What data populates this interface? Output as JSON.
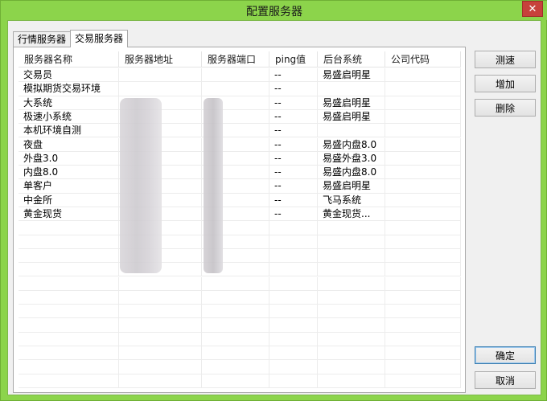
{
  "window": {
    "title": "配置服务器",
    "close_label": "✕"
  },
  "tabs": [
    {
      "label": "行情服务器",
      "active": false
    },
    {
      "label": "交易服务器",
      "active": true
    }
  ],
  "table": {
    "columns": [
      "服务器名称",
      "服务器地址",
      "服务器端口",
      "ping值",
      "后台系统",
      "公司代码"
    ],
    "rows": [
      {
        "name": "交易员",
        "ping": "--",
        "backend": "易盛启明星",
        "company": ""
      },
      {
        "name": "模拟期货交易环境",
        "ping": "--",
        "backend": "",
        "company": ""
      },
      {
        "name": "大系统",
        "ping": "--",
        "backend": "易盛启明星",
        "company": ""
      },
      {
        "name": "极速小系统",
        "ping": "--",
        "backend": "易盛启明星",
        "company": ""
      },
      {
        "name": "本机环境自测",
        "ping": "--",
        "backend": "",
        "company": ""
      },
      {
        "name": "夜盘",
        "ping": "--",
        "backend": "易盛内盘8.0",
        "company": ""
      },
      {
        "name": "外盘3.0",
        "ping": "--",
        "backend": "易盛外盘3.0",
        "company": ""
      },
      {
        "name": "内盘8.0",
        "ping": "--",
        "backend": "易盛内盘8.0",
        "company": ""
      },
      {
        "name": "单客户",
        "ping": "--",
        "backend": "易盛启明星",
        "company": ""
      },
      {
        "name": "中金所",
        "ping": "--",
        "backend": "飞马系统",
        "company": ""
      },
      {
        "name": "黄金现货",
        "ping": "--",
        "backend": "黄金现货...",
        "company": ""
      }
    ]
  },
  "buttons": {
    "test_speed": "测速",
    "add": "增加",
    "delete": "删除",
    "ok": "确定",
    "cancel": "取消"
  }
}
